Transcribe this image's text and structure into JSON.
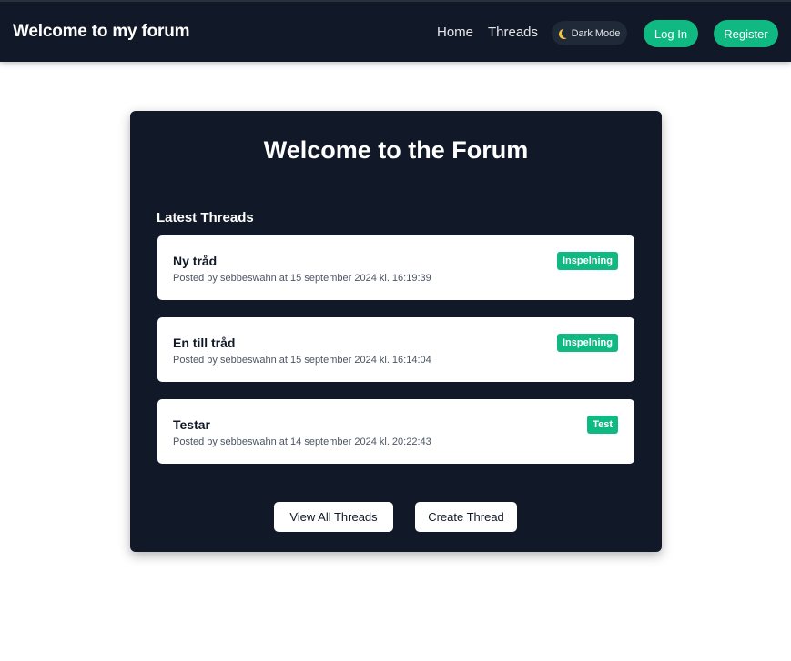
{
  "header": {
    "brand": "Welcome to my forum",
    "nav": {
      "home": "Home",
      "threads": "Threads"
    },
    "dark_mode_label": "Dark Mode",
    "login_label": "Log In",
    "register_label": "Register"
  },
  "main": {
    "title": "Welcome to the Forum",
    "latest_label": "Latest Threads",
    "threads": [
      {
        "title": "Ny tråd",
        "meta": "Posted by sebbeswahn at 15 september 2024 kl. 16:19:39",
        "tag": "Inspelning"
      },
      {
        "title": "En till tråd",
        "meta": "Posted by sebbeswahn at 15 september 2024 kl. 16:14:04",
        "tag": "Inspelning"
      },
      {
        "title": "Testar",
        "meta": "Posted by sebbeswahn at 14 september 2024 kl. 20:22:43",
        "tag": "Test"
      }
    ],
    "view_all_label": "View All Threads",
    "create_label": "Create Thread"
  },
  "colors": {
    "navbar_bg": "#111827",
    "accent": "#10b981",
    "card_bg": "#111827"
  },
  "icons": {
    "dark_mode": "moon-icon"
  }
}
